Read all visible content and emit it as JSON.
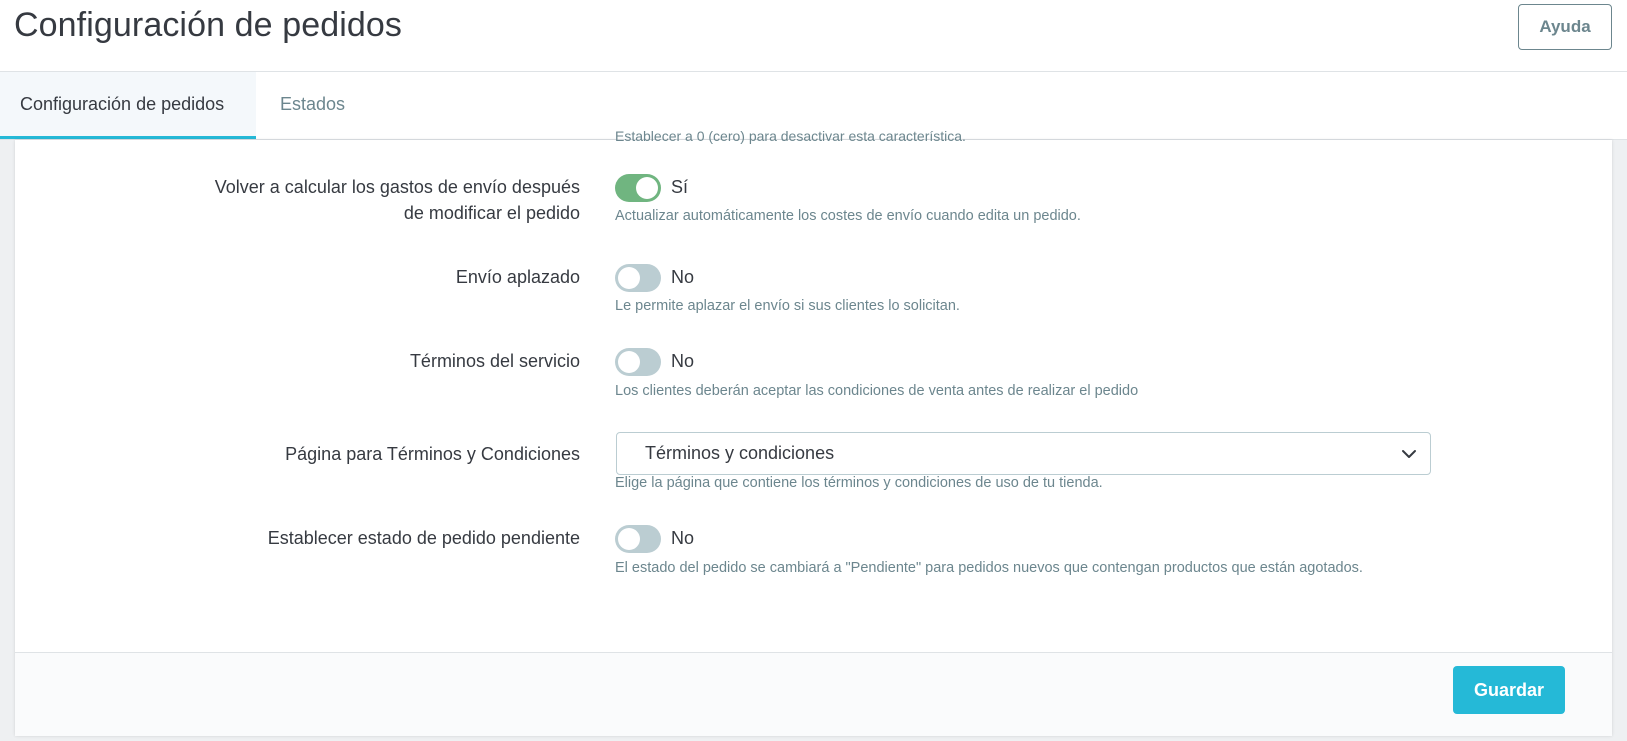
{
  "header": {
    "title": "Configuración de pedidos",
    "help_label": "Ayuda"
  },
  "tabs": [
    {
      "label": "Configuración de pedidos",
      "active": true
    },
    {
      "label": "Estados",
      "active": false
    }
  ],
  "form": {
    "clipped_help": "Establecer a 0 (cero) para desactivar esta característica.",
    "recalculate_shipping": {
      "label_line1": "Volver a calcular los gastos de envío después",
      "label_line2": "de modificar el pedido",
      "value": true,
      "value_text": "Sí",
      "help": "Actualizar automáticamente los costes de envío cuando edita un pedido."
    },
    "deferred_shipping": {
      "label": "Envío aplazado",
      "value": false,
      "value_text": "No",
      "help": "Le permite aplazar el envío si sus clientes lo solicitan."
    },
    "terms_of_service": {
      "label": "Términos del servicio",
      "value": false,
      "value_text": "No",
      "help": "Los clientes deberán aceptar las condiciones de venta antes de realizar el pedido"
    },
    "terms_page": {
      "label": "Página para Términos y Condiciones",
      "selected": "Términos y condiciones",
      "help": "Elige la página que contiene los términos y condiciones de uso de tu tienda."
    },
    "pending_status": {
      "label": "Establecer estado de pedido pendiente",
      "value": false,
      "value_text": "No",
      "help": "El estado del pedido se cambiará a \"Pendiente\" para pedidos nuevos que contengan productos que están agotados."
    }
  },
  "footer": {
    "save_label": "Guardar"
  },
  "colors": {
    "accent": "#25b9d7",
    "switch_on": "#70b580",
    "switch_off": "#bbcdd2",
    "text": "#363a41",
    "muted": "#6c868e"
  },
  "icons": {
    "select_chevron": "chevron-down-icon"
  }
}
